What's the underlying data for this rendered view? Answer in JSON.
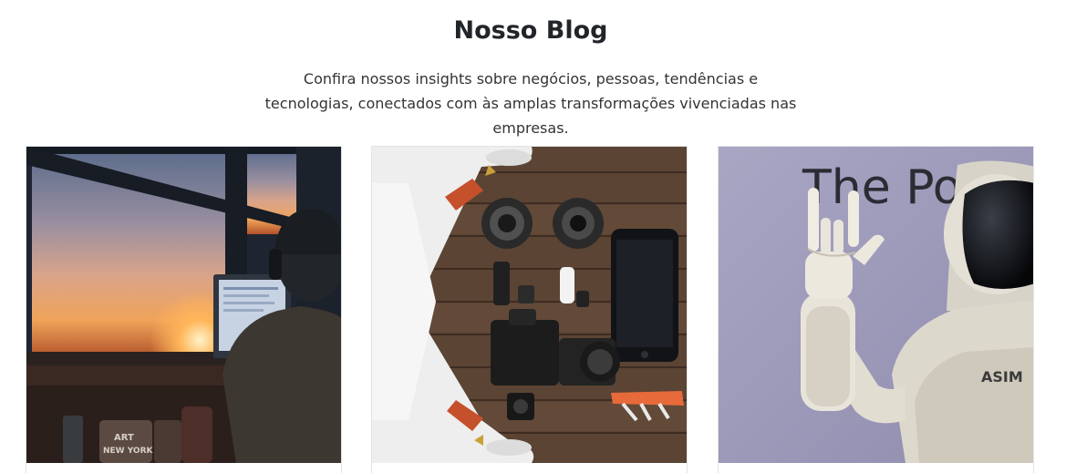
{
  "blog": {
    "title": "Nosso Blog",
    "subtitle": "Confira nossos insights sobre negócios, pessoas, tendências e tecnologias, conectados com às amplas transformações vivenciadas nas empresas."
  },
  "cards": [
    {
      "image_subject": "person-at-computer-sunset-photo",
      "mug_text_line1": "ART",
      "mug_text_line2": "NEW YORK"
    },
    {
      "image_subject": "drone-and-camera-gear-flatlay-photo"
    },
    {
      "image_subject": "asimo-robot-waving-photo",
      "banner_text": "The Po",
      "robot_text": "ASIM"
    }
  ],
  "colors": {
    "title": "#212529",
    "text": "#333333",
    "card_border": "#e3e3e3"
  }
}
